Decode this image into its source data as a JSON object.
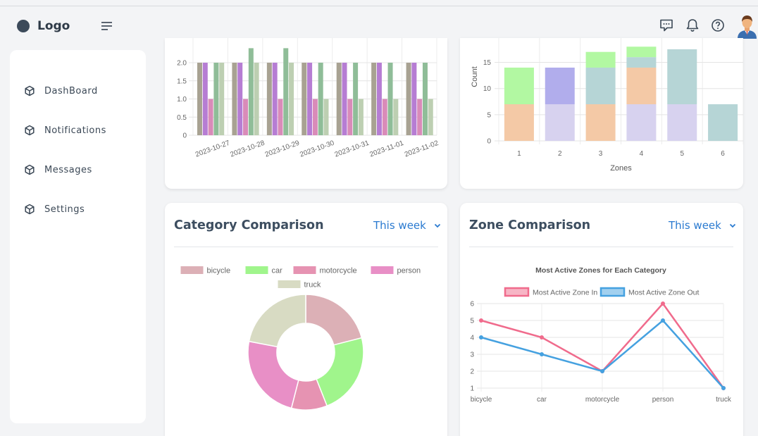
{
  "header": {
    "logo_text": "Logo",
    "icons": [
      "menu-icon",
      "chat-icon",
      "bell-icon",
      "help-icon",
      "avatar"
    ]
  },
  "sidebar": {
    "items": [
      {
        "label": "DashBoard",
        "icon": "cube-icon"
      },
      {
        "label": "Notifications",
        "icon": "cube-icon"
      },
      {
        "label": "Messages",
        "icon": "cube-icon"
      },
      {
        "label": "Settings",
        "icon": "cube-icon"
      }
    ]
  },
  "cards": {
    "category": {
      "title": "Category Comparison",
      "period": "This week"
    },
    "zone": {
      "title": "Zone Comparison",
      "period": "This week"
    }
  },
  "colors": {
    "accent": "#2a7ad0",
    "bicycle": "#dcb0b6",
    "car": "#a0f58c",
    "motorcycle": "#e693b2",
    "person": "#e88fc6",
    "truck": "#d8dbc3"
  },
  "chart_data": [
    {
      "type": "bar",
      "categories": [
        "2023-10-27",
        "2023-10-28",
        "2023-10-29",
        "2023-10-30",
        "2023-10-31",
        "2023-11-01",
        "2023-11-02"
      ],
      "ytick_labels": [
        "0",
        "0.5",
        "1.0",
        "1.5",
        "2.0"
      ],
      "ylim": [
        0,
        2.35
      ],
      "grid": true,
      "series": [
        {
          "color": "#a8a292",
          "values": [
            2,
            2,
            2,
            2,
            2,
            2,
            2
          ]
        },
        {
          "color": "#b67dd3",
          "values": [
            2,
            2,
            2,
            2,
            2,
            2,
            2
          ]
        },
        {
          "color": "#d98bb9",
          "values": [
            1,
            1,
            1,
            1,
            1,
            1,
            1
          ]
        },
        {
          "color": "#8fbd98",
          "values": [
            2,
            2.4,
            2.4,
            2,
            2,
            2,
            2
          ]
        },
        {
          "color": "#bdcfb2",
          "values": [
            2,
            2,
            2,
            1,
            1,
            1,
            1
          ]
        }
      ]
    },
    {
      "type": "bar",
      "stacked": true,
      "categories": [
        "1",
        "2",
        "3",
        "4",
        "5",
        "6"
      ],
      "xlabel": "Zones",
      "ylabel": "Count",
      "ytick_labels": [
        "0",
        "5",
        "10",
        "15"
      ],
      "ylim": [
        0,
        17.5
      ],
      "grid": true,
      "series": [
        {
          "color": "#f4c9a6",
          "values": [
            7,
            0,
            7,
            0,
            0,
            0
          ]
        },
        {
          "color": "#d7d2ef",
          "values": [
            0,
            7,
            0,
            7,
            7,
            0
          ]
        },
        {
          "color": "#f4c9a6",
          "values": [
            0,
            0,
            0,
            7,
            0,
            0
          ]
        },
        {
          "color": "#b6d5d6",
          "values": [
            0,
            0,
            7,
            2,
            10.5,
            7
          ]
        },
        {
          "color": "#b1adec",
          "values": [
            0,
            7,
            0,
            0,
            0,
            0
          ]
        },
        {
          "color": "#b2f8a2",
          "values": [
            7,
            0,
            3,
            2,
            0,
            0
          ]
        }
      ]
    },
    {
      "type": "pie",
      "donut": true,
      "legend_position": "top",
      "labels": [
        "bicycle",
        "car",
        "motorcycle",
        "person",
        "truck"
      ],
      "values": [
        21,
        23,
        10,
        24,
        22
      ]
    },
    {
      "type": "line",
      "title": "Most Active Zones for Each Category",
      "legend_position": "top",
      "categories": [
        "bicycle",
        "car",
        "motorcycle",
        "person",
        "truck"
      ],
      "ytick_labels": [
        "1",
        "2",
        "3",
        "4",
        "5",
        "6"
      ],
      "ylim": [
        1,
        6
      ],
      "grid": true,
      "series": [
        {
          "name": "Most Active Zone In",
          "color": "#f06b8c",
          "values": [
            5,
            4,
            2,
            6,
            1
          ]
        },
        {
          "name": "Most Active Zone Out",
          "color": "#45a1e0",
          "values": [
            4,
            3,
            2,
            5,
            1
          ]
        }
      ]
    }
  ]
}
